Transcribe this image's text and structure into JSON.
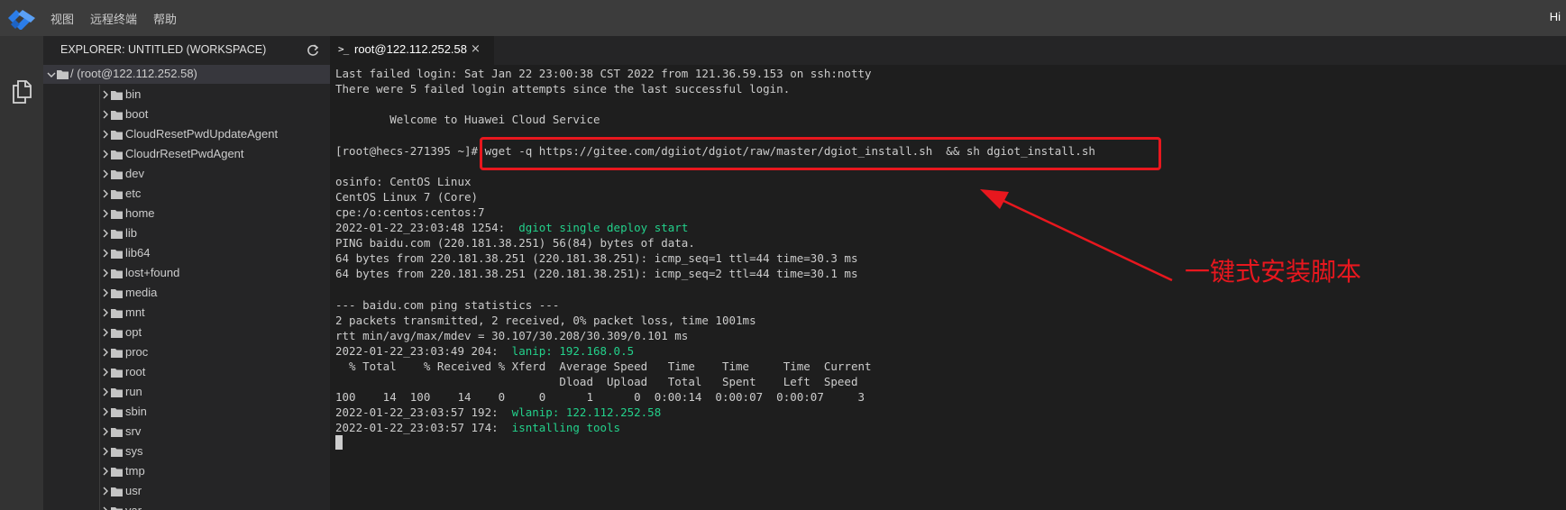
{
  "menubar": {
    "items": [
      "视图",
      "远程终端",
      "帮助"
    ],
    "user_greeting": "Hi",
    "logo_icon": "diamond-logo-icon"
  },
  "colors": {
    "menubar_bg": "#3c3c3c",
    "activitybar_bg": "#333333",
    "sidebar_bg": "#252526",
    "terminal_bg": "#1e1e1e",
    "terminal_green": "#23d18b",
    "annotation_red": "#e8171e",
    "logo_blue": "#2b7de9"
  },
  "activitybar": {
    "icon": "files-icon"
  },
  "sidebar": {
    "title": "EXPLORER: UNTITLED (WORKSPACE)",
    "refresh_icon": "refresh-icon",
    "root": "/ (root@122.112.252.58)",
    "folders": [
      "bin",
      "boot",
      "CloudResetPwdUpdateAgent",
      "CloudrResetPwdAgent",
      "dev",
      "etc",
      "home",
      "lib",
      "lib64",
      "lost+found",
      "media",
      "mnt",
      "opt",
      "proc",
      "root",
      "run",
      "sbin",
      "srv",
      "sys",
      "tmp",
      "usr",
      "var"
    ]
  },
  "tab": {
    "prompt": ">_",
    "label": "root@122.112.252.58",
    "close": "×"
  },
  "terminal": {
    "lines": [
      {
        "text": "Last failed login: Sat Jan 22 23:00:38 CST 2022 from 121.36.59.153 on ssh:notty"
      },
      {
        "text": "There were 5 failed login attempts since the last successful login."
      },
      {
        "text": ""
      },
      {
        "text": "        Welcome to Huawei Cloud Service"
      },
      {
        "text": ""
      },
      {
        "text": "[root@hecs-271395 ~]# wget -q https://gitee.com/dgiiot/dgiot/raw/master/dgiot_install.sh  && sh dgiot_install.sh"
      },
      {
        "text": ""
      },
      {
        "text": "osinfo: CentOS Linux"
      },
      {
        "text": "CentOS Linux 7 (Core)"
      },
      {
        "text": "cpe:/o:centos:centos:7"
      },
      {
        "text": "2022-01-22_23:03:48 1254:  ",
        "green": "dgiot single deploy start"
      },
      {
        "text": "PING baidu.com (220.181.38.251) 56(84) bytes of data."
      },
      {
        "text": "64 bytes from 220.181.38.251 (220.181.38.251): icmp_seq=1 ttl=44 time=30.3 ms"
      },
      {
        "text": "64 bytes from 220.181.38.251 (220.181.38.251): icmp_seq=2 ttl=44 time=30.1 ms"
      },
      {
        "text": ""
      },
      {
        "text": "--- baidu.com ping statistics ---"
      },
      {
        "text": "2 packets transmitted, 2 received, 0% packet loss, time 1001ms"
      },
      {
        "text": "rtt min/avg/max/mdev = 30.107/30.208/30.309/0.101 ms"
      },
      {
        "text": "2022-01-22_23:03:49 204:  ",
        "green": "lanip: 192.168.0.5"
      },
      {
        "text": "  % Total    % Received % Xferd  Average Speed   Time    Time     Time  Current"
      },
      {
        "text": "                                 Dload  Upload   Total   Spent    Left  Speed"
      },
      {
        "text": "100    14  100    14    0     0      1      0  0:00:14  0:00:07  0:00:07     3"
      },
      {
        "text": "2022-01-22_23:03:57 192:  ",
        "green": "wlanip: 122.112.252.58"
      },
      {
        "text": "2022-01-22_23:03:57 174:  ",
        "green": "isntalling tools"
      }
    ]
  },
  "annotation": {
    "text": "一键式安装脚本",
    "arrow_icon": "red-arrow-icon"
  }
}
